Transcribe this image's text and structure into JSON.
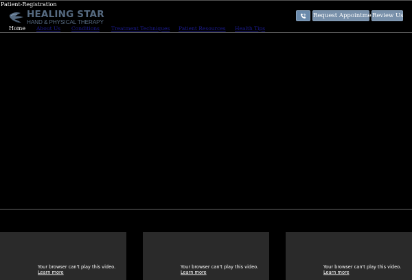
{
  "top_bar": {
    "patient_registration": "Patient-Registration"
  },
  "logo": {
    "title": "HEALING STAR",
    "subtitle": "HAND & PHYSICAL THERAPY",
    "icon": "star-hand-icon"
  },
  "header_buttons": {
    "phone_icon": "phone-icon",
    "request_appointment": "Request Appointment",
    "review_us": "Review Us"
  },
  "nav": {
    "items": [
      {
        "label": "Home"
      },
      {
        "label": "About Us"
      },
      {
        "label": "Conditions"
      },
      {
        "label": "Treatment Techniques"
      },
      {
        "label": "Patient Resources"
      },
      {
        "label": "Health Tips"
      }
    ]
  },
  "videos": [
    {
      "message": "Your browser can't play this video.",
      "link": "Learn more"
    },
    {
      "message": "Your browser can't play this video.",
      "link": "Learn more"
    },
    {
      "message": "Your browser can't play this video.",
      "link": "Learn more"
    }
  ],
  "colors": {
    "background": "#000000",
    "logo": "#566a80",
    "button": "#7890aa",
    "nav_link": "#1a1a8c",
    "video_panel": "#2a2a2a"
  }
}
